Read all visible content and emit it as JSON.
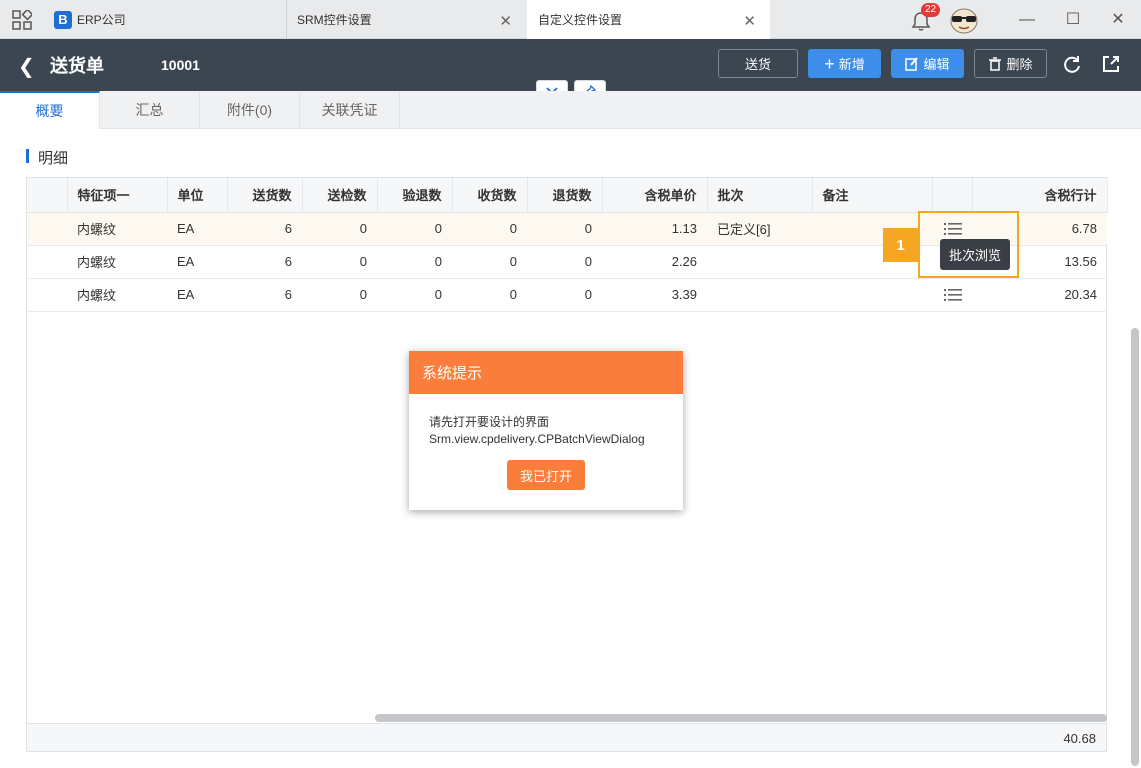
{
  "titlebar": {
    "tabs": [
      {
        "label": "ERP公司",
        "active": false
      },
      {
        "label": "SRM控件设置",
        "active": false
      },
      {
        "label": "自定义控件设置",
        "active": true
      }
    ],
    "notification_count": "22",
    "logo_letter": "B"
  },
  "header": {
    "title": "送货单",
    "doc_no": "10001",
    "buttons": {
      "deliver": "送货",
      "new": "新增",
      "edit": "编辑",
      "delete": "删除"
    }
  },
  "subtabs": [
    "概要",
    "汇总",
    "附件(0)",
    "关联凭证"
  ],
  "section_title": "明细",
  "table": {
    "columns": [
      "特征项一",
      "单位",
      "送货数",
      "送检数",
      "验退数",
      "收货数",
      "退货数",
      "含税单价",
      "批次",
      "备注",
      "",
      "含税行计"
    ],
    "rows": [
      [
        "内螺纹",
        "EA",
        "6",
        "0",
        "0",
        "0",
        "0",
        "1.13",
        "已定义[6]",
        "",
        "",
        "6.78"
      ],
      [
        "内螺纹",
        "EA",
        "6",
        "0",
        "0",
        "0",
        "0",
        "2.26",
        "",
        "",
        "",
        "13.56"
      ],
      [
        "内螺纹",
        "EA",
        "6",
        "0",
        "0",
        "0",
        "0",
        "3.39",
        "",
        "",
        "",
        "20.34"
      ]
    ],
    "footer_total": "40.68"
  },
  "annotation": {
    "step": "1",
    "tooltip": "批次浏览"
  },
  "dialog": {
    "title": "系统提示",
    "message_line1": "请先打开要设计的界面",
    "message_line2": "Srm.view.cpdelivery.CPBatchViewDialog",
    "button": "我已打开"
  },
  "colors": {
    "accent": "#1f6fd1",
    "header_bg": "#3c4650",
    "dialog_orange": "#fb7d3b",
    "highlight": "#f5a623"
  }
}
